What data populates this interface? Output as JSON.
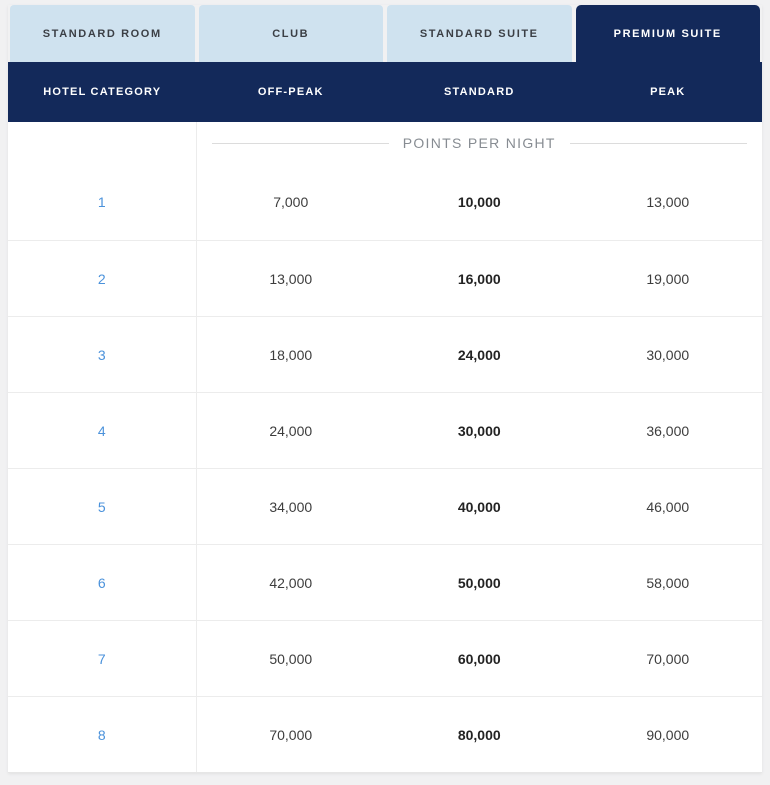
{
  "widget": "award-points-per-night-table",
  "colors": {
    "navy": "#13295a",
    "tab_blue": "#cfe2ef",
    "link_blue": "#4b92db",
    "page_bg": "#f1f1f2"
  },
  "tabs": [
    {
      "label": "STANDARD ROOM",
      "active": false
    },
    {
      "label": "CLUB",
      "active": false
    },
    {
      "label": "STANDARD SUITE",
      "active": false
    },
    {
      "label": "PREMIUM SUITE",
      "active": true
    }
  ],
  "header_columns": [
    {
      "label": "HOTEL CATEGORY"
    },
    {
      "label": "OFF-PEAK"
    },
    {
      "label": "STANDARD"
    },
    {
      "label": "PEAK"
    }
  ],
  "caption": "POINTS PER NIGHT",
  "rows": [
    {
      "category": "1",
      "off_peak": "7,000",
      "standard": "10,000",
      "peak": "13,000"
    },
    {
      "category": "2",
      "off_peak": "13,000",
      "standard": "16,000",
      "peak": "19,000"
    },
    {
      "category": "3",
      "off_peak": "18,000",
      "standard": "24,000",
      "peak": "30,000"
    },
    {
      "category": "4",
      "off_peak": "24,000",
      "standard": "30,000",
      "peak": "36,000"
    },
    {
      "category": "5",
      "off_peak": "34,000",
      "standard": "40,000",
      "peak": "46,000"
    },
    {
      "category": "6",
      "off_peak": "42,000",
      "standard": "50,000",
      "peak": "58,000"
    },
    {
      "category": "7",
      "off_peak": "50,000",
      "standard": "60,000",
      "peak": "70,000"
    },
    {
      "category": "8",
      "off_peak": "70,000",
      "standard": "80,000",
      "peak": "90,000"
    }
  ]
}
